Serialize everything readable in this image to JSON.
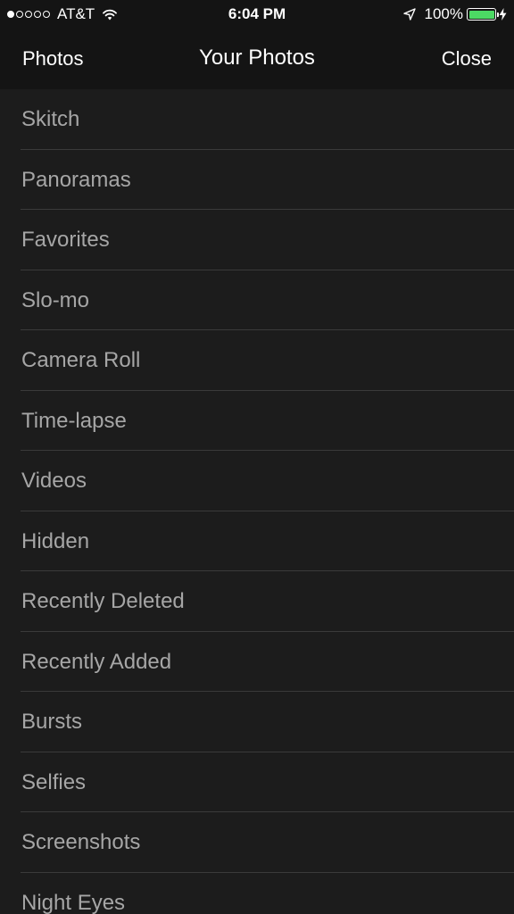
{
  "status_bar": {
    "signal_filled": 1,
    "signal_total": 5,
    "carrier": "AT&T",
    "time": "6:04 PM",
    "battery_percent": "100%",
    "battery_level": 1.0,
    "battery_color": "#4cd964",
    "icons": [
      "wifi-icon",
      "location-arrow-icon",
      "battery-icon",
      "charging-bolt-icon"
    ]
  },
  "nav": {
    "back_label": "Photos",
    "title": "Your Photos",
    "close_label": "Close"
  },
  "albums": [
    {
      "label": "Skitch"
    },
    {
      "label": "Panoramas"
    },
    {
      "label": "Favorites"
    },
    {
      "label": "Slo-mo"
    },
    {
      "label": "Camera Roll"
    },
    {
      "label": "Time-lapse"
    },
    {
      "label": "Videos"
    },
    {
      "label": "Hidden"
    },
    {
      "label": "Recently Deleted"
    },
    {
      "label": "Recently Added"
    },
    {
      "label": "Bursts"
    },
    {
      "label": "Selfies"
    },
    {
      "label": "Screenshots"
    },
    {
      "label": "Night Eyes"
    }
  ]
}
